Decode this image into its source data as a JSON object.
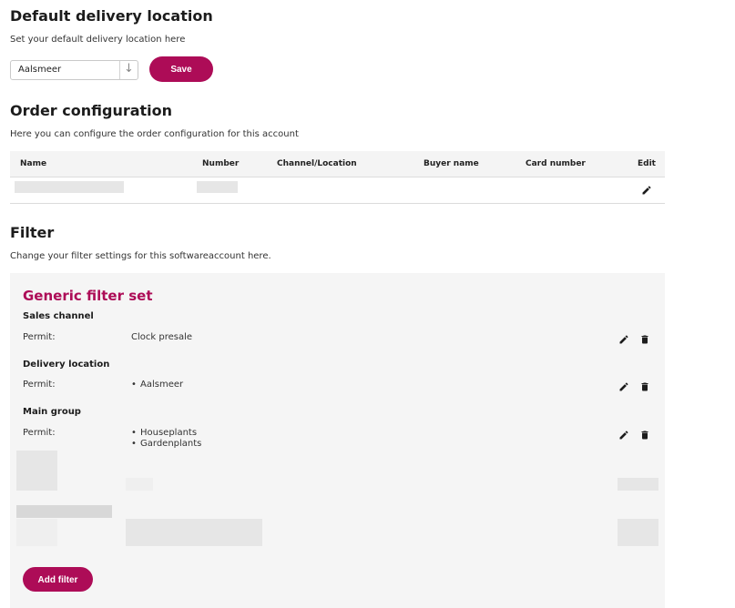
{
  "delivery": {
    "title": "Default delivery location",
    "description": "Set your default delivery location here",
    "selected_location": "Aalsmeer",
    "save_label": "Save"
  },
  "order_config": {
    "title": "Order configuration",
    "description": "Here you can configure the order configuration for this account",
    "columns": {
      "name": "Name",
      "number": "Number",
      "channel": "Channel/Location",
      "buyer": "Buyer name",
      "card": "Card number",
      "edit": "Edit"
    }
  },
  "filter": {
    "title": "Filter",
    "description": "Change your filter settings for this softwareaccount here.",
    "set_title": "Generic filter set",
    "groups": [
      {
        "name": "Sales channel",
        "permit_label": "Permit:",
        "values": [
          "Clock presale"
        ]
      },
      {
        "name": "Delivery location",
        "permit_label": "Permit:",
        "values": [
          "Aalsmeer"
        ]
      },
      {
        "name": "Main group",
        "permit_label": "Permit:",
        "values": [
          "Houseplants",
          "Gardenplants"
        ]
      }
    ],
    "add_label": "Add filter"
  },
  "colors": {
    "accent": "#ad0c57",
    "panel": "#f5f5f5"
  },
  "icons": {
    "edit": "pencil-icon",
    "delete": "trash-icon",
    "dropdown": "arrow-down-icon"
  }
}
